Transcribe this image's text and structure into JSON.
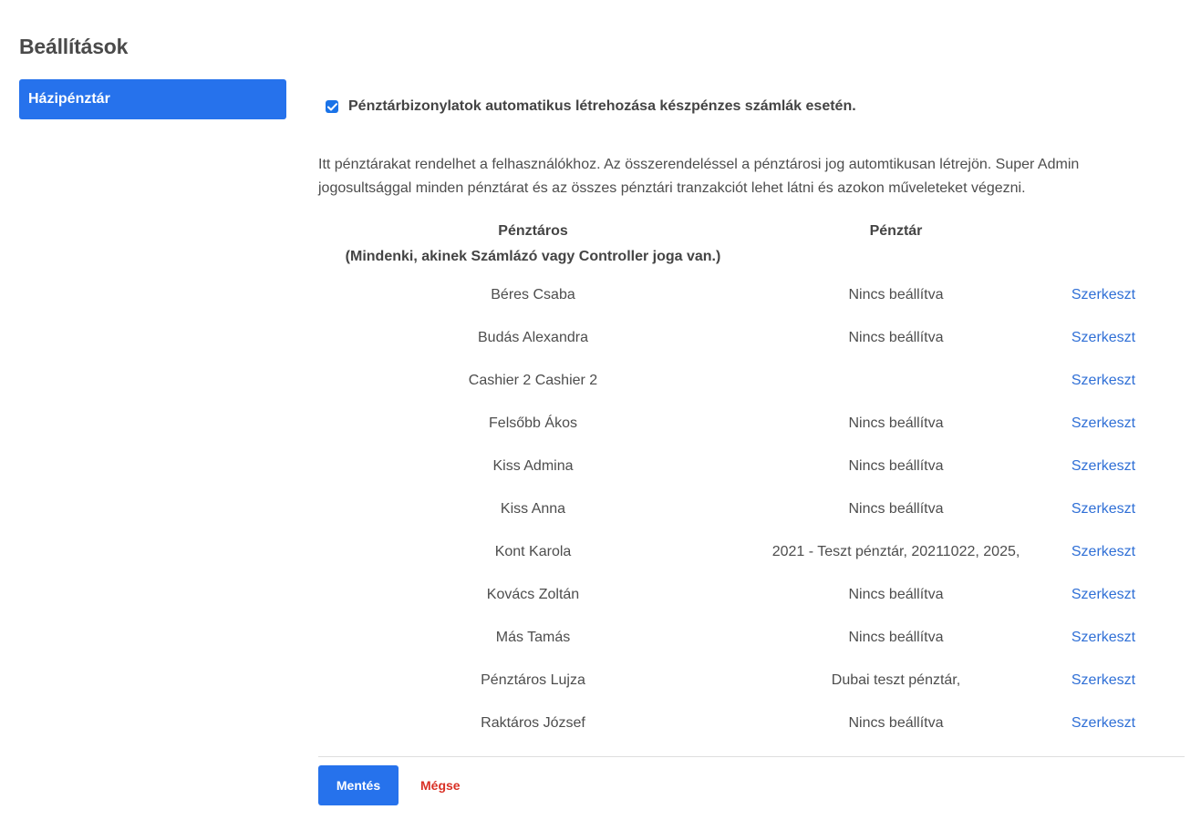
{
  "page": {
    "title": "Beállítások"
  },
  "sidebar": {
    "items": [
      {
        "label": "Házipénztár",
        "active": true
      }
    ]
  },
  "settings": {
    "auto_receipts": {
      "label": "Pénztárbizonylatok automatikus létrehozása készpénzes számlák esetén.",
      "checked": true
    },
    "description": "Itt pénztárakat rendelhet a felhasználókhoz. Az összerendeléssel a pénztárosi jog automtikusan létrejön. Super Admin jogosultsággal minden pénztárat és az összes pénztári tranzakciót lehet látni és azokon műveleteket végezni."
  },
  "table": {
    "headers": {
      "cashier": "Pénztáros",
      "cashier_note": "(Mindenki, akinek Számlázó vagy Controller joga van.)",
      "register": "Pénztár"
    },
    "rows": [
      {
        "name": "Béres Csaba",
        "register": "Nincs beállítva",
        "action": "Szerkeszt"
      },
      {
        "name": "Budás Alexandra",
        "register": "Nincs beállítva",
        "action": "Szerkeszt"
      },
      {
        "name": "Cashier 2 Cashier 2",
        "register": "",
        "action": "Szerkeszt"
      },
      {
        "name": "Felsőbb Ákos",
        "register": "Nincs beállítva",
        "action": "Szerkeszt"
      },
      {
        "name": "Kiss Admina",
        "register": "Nincs beállítva",
        "action": "Szerkeszt"
      },
      {
        "name": "Kiss Anna",
        "register": "Nincs beállítva",
        "action": "Szerkeszt"
      },
      {
        "name": "Kont Karola",
        "register": "2021 - Teszt pénztár, 20211022, 2025,",
        "action": "Szerkeszt"
      },
      {
        "name": "Kovács Zoltán",
        "register": "Nincs beállítva",
        "action": "Szerkeszt"
      },
      {
        "name": "Más Tamás",
        "register": "Nincs beállítva",
        "action": "Szerkeszt"
      },
      {
        "name": "Pénztáros Lujza",
        "register": "Dubai teszt pénztár,",
        "action": "Szerkeszt"
      },
      {
        "name": "Raktáros József",
        "register": "Nincs beállítva",
        "action": "Szerkeszt"
      }
    ]
  },
  "footer": {
    "save_label": "Mentés",
    "cancel_label": "Mégse"
  },
  "colors": {
    "primary": "#2672ec",
    "link": "#2f6fd6",
    "danger": "#d93025",
    "text": "#444444"
  }
}
